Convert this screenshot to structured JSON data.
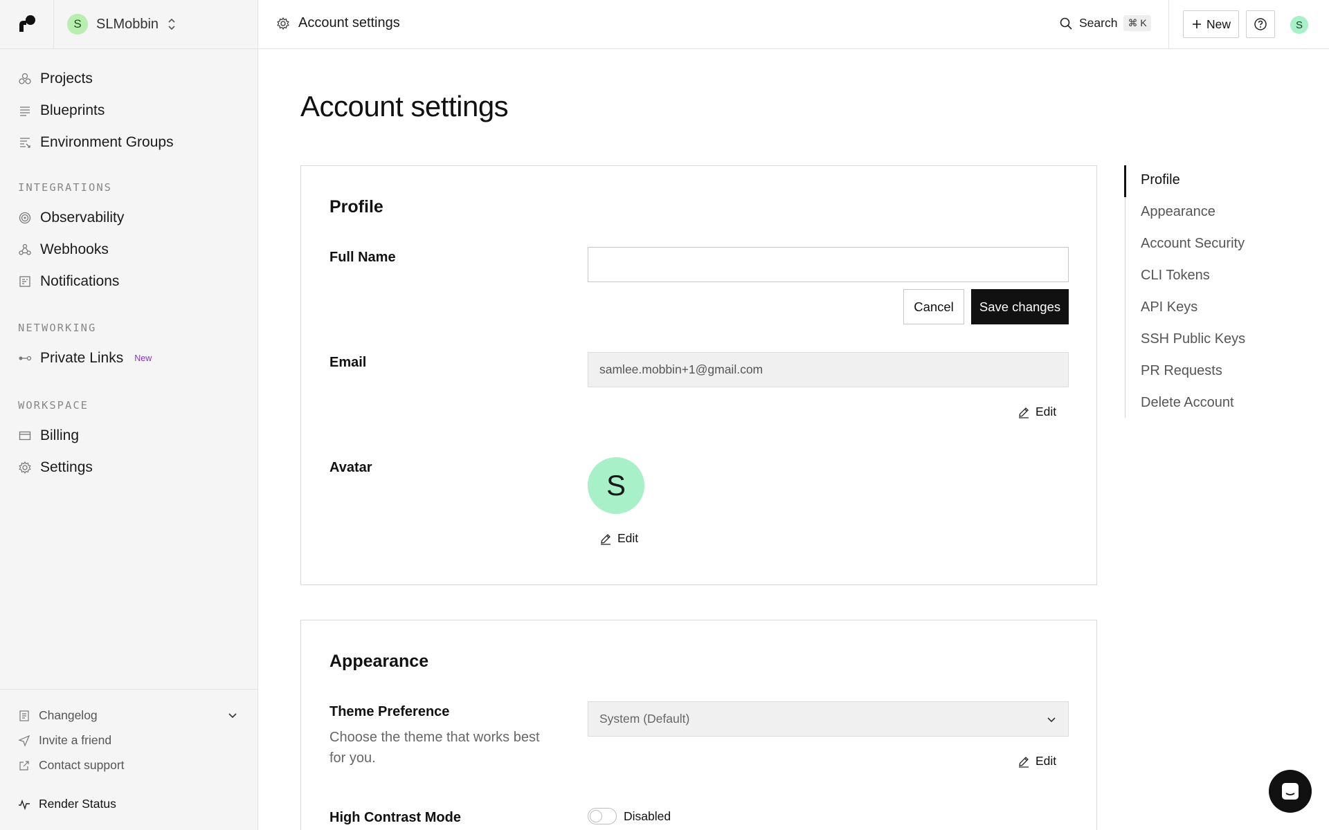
{
  "workspace": {
    "initial": "S",
    "name": "SLMobbin"
  },
  "sidebar": {
    "main_items": [
      {
        "label": "Projects",
        "icon": "projects-icon"
      },
      {
        "label": "Blueprints",
        "icon": "blueprints-icon"
      },
      {
        "label": "Environment Groups",
        "icon": "environment-groups-icon"
      }
    ],
    "sections": [
      {
        "title": "INTEGRATIONS",
        "items": [
          {
            "label": "Observability",
            "icon": "observability-icon"
          },
          {
            "label": "Webhooks",
            "icon": "webhooks-icon"
          },
          {
            "label": "Notifications",
            "icon": "notifications-icon"
          }
        ]
      },
      {
        "title": "NETWORKING",
        "items": [
          {
            "label": "Private Links",
            "icon": "private-links-icon",
            "badge": "New"
          }
        ]
      },
      {
        "title": "WORKSPACE",
        "items": [
          {
            "label": "Billing",
            "icon": "billing-icon"
          },
          {
            "label": "Settings",
            "icon": "settings-icon"
          }
        ]
      }
    ],
    "footer": {
      "changelog": "Changelog",
      "invite": "Invite a friend",
      "support": "Contact support",
      "status": "Render Status"
    }
  },
  "topbar": {
    "breadcrumb": "Account settings",
    "search_label": "Search",
    "search_shortcut": "⌘ K",
    "new_label": "New",
    "user_initial": "S"
  },
  "page": {
    "title": "Account settings",
    "profile": {
      "title": "Profile",
      "full_name_label": "Full Name",
      "full_name_value": "",
      "cancel_label": "Cancel",
      "save_label": "Save changes",
      "email_label": "Email",
      "email_value": "samlee.mobbin+1@gmail.com",
      "edit_label": "Edit",
      "avatar_label": "Avatar",
      "avatar_initial": "S"
    },
    "appearance": {
      "title": "Appearance",
      "theme_label": "Theme Preference",
      "theme_desc": "Choose the theme that works best for you.",
      "theme_value": "System (Default)",
      "edit_label": "Edit",
      "contrast_label": "High Contrast Mode",
      "contrast_value": "Disabled"
    }
  },
  "toc": {
    "items": [
      "Profile",
      "Appearance",
      "Account Security",
      "CLI Tokens",
      "API Keys",
      "SSH Public Keys",
      "PR Requests",
      "Delete Account"
    ],
    "active": "Profile"
  },
  "colors": {
    "avatar_green": "#a8f0c8",
    "workspace_green": "#b8eeb0",
    "badge_purple": "#8a2be2",
    "primary_button": "#111111"
  }
}
